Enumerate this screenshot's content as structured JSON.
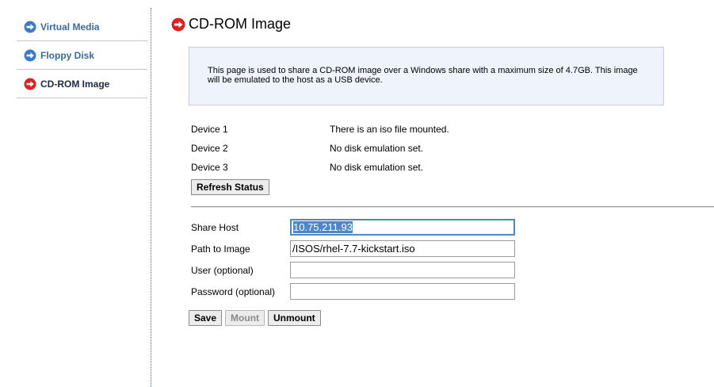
{
  "sidebar": {
    "items": [
      {
        "label": "Virtual Media",
        "icon": "arrow-right-circle-blue-icon",
        "active": false
      },
      {
        "label": "Floppy Disk",
        "icon": "arrow-right-circle-blue-icon",
        "active": false
      },
      {
        "label": "CD-ROM Image",
        "icon": "arrow-right-circle-red-icon",
        "active": true
      }
    ]
  },
  "header": {
    "title": "CD-ROM Image",
    "icon": "arrow-right-circle-red-icon"
  },
  "info": {
    "text": "This page is used to share a CD-ROM image over a Windows share with a maximum size of 4.7GB. This image will be emulated to the host as a USB device."
  },
  "status": {
    "devices": [
      {
        "name": "Device 1",
        "status": "There is an iso file mounted."
      },
      {
        "name": "Device 2",
        "status": "No disk emulation set."
      },
      {
        "name": "Device 3",
        "status": "No disk emulation set."
      }
    ],
    "refresh_label": "Refresh Status"
  },
  "form": {
    "share_host": {
      "label": "Share Host",
      "value": "10.75.211.93"
    },
    "path": {
      "label": "Path to Image",
      "value": "/ISOS/rhel-7.7-kickstart.iso"
    },
    "user": {
      "label": "User (optional)",
      "value": ""
    },
    "password": {
      "label": "Password (optional)",
      "value": ""
    }
  },
  "actions": {
    "save_label": "Save",
    "mount_label": "Mount",
    "unmount_label": "Unmount"
  },
  "colors": {
    "accent_blue": "#3a6a9a",
    "accent_red": "#e02020",
    "info_bg": "#eef3fc",
    "focus": "#4f86c6"
  }
}
